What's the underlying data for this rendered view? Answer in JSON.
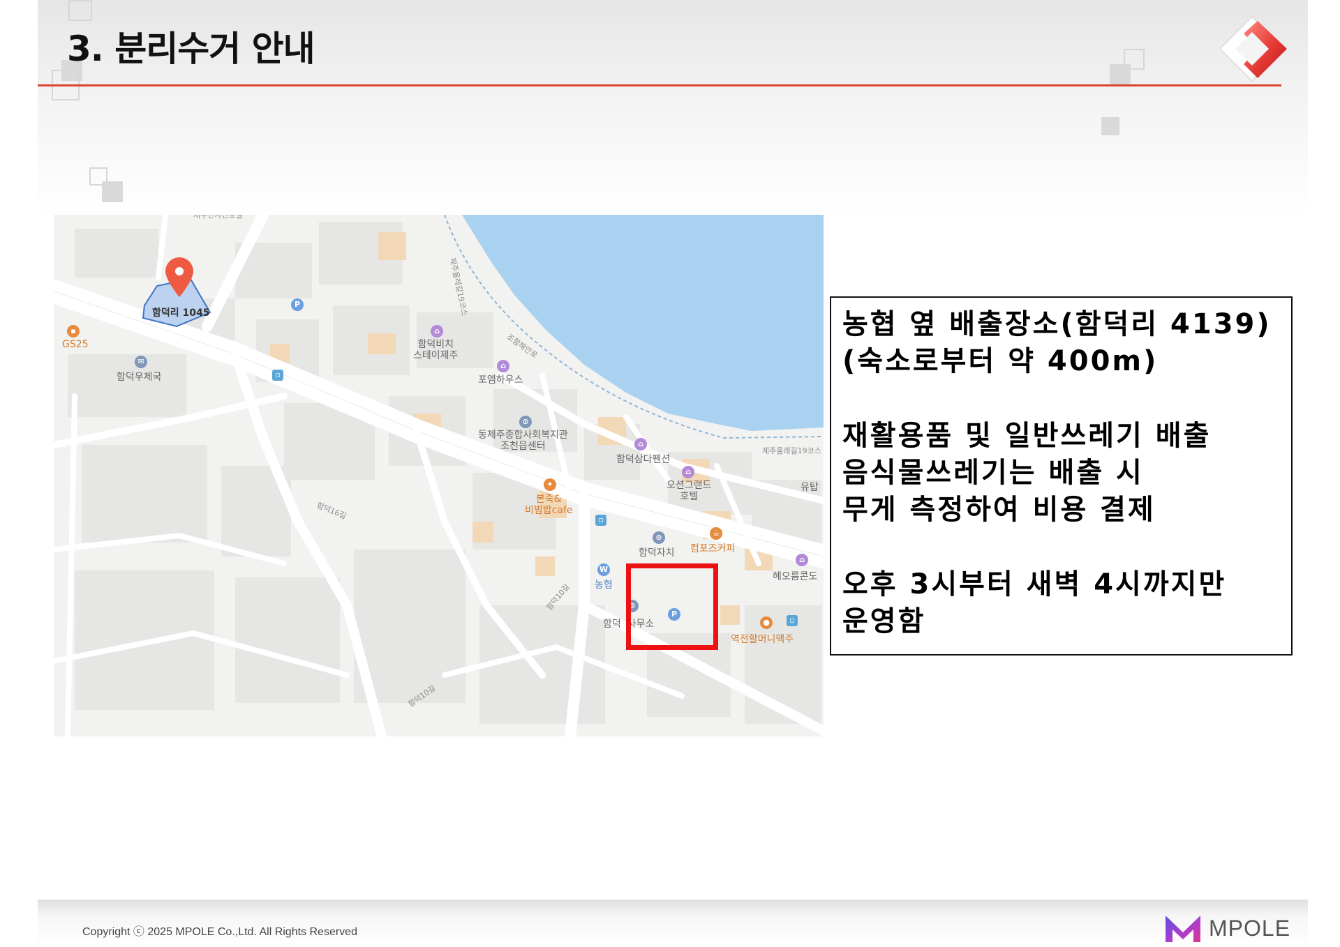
{
  "header": {
    "title": "3. 분리수거 안내"
  },
  "map": {
    "labels": {
      "top_cut": "제주민사진호텔",
      "pin_area": "함덕리 1045",
      "gs25": "GS25",
      "post_office": "함덕우체국",
      "stay_jeju": "함덕비치\n스테이제주",
      "forem": "포엠하우스",
      "coast_road": "조함해안로",
      "welfare": "동제주종합사회복지관\n조천읍센터",
      "samda": "함덕삼다펜션",
      "ocean_grand": "오션그랜드\n호텔",
      "bonjuk": "본죽&\n비빔밥cafe",
      "compose": "컴포즈커피",
      "autonomy": "함덕자치",
      "nonghyup": "농협",
      "office": "함덕  사무소",
      "yeokjeon": "역전할머니맥주",
      "heoreum": "헤오름콘도",
      "yutap": "유탑",
      "olle": "제주올레길19코스",
      "olle_vertical": "제주올레길19코스",
      "road_16": "함덕16길",
      "road_10a": "함덕10길",
      "road_10b": "함덕10길"
    }
  },
  "info": {
    "lines": [
      "농협 옆 배출장소(함덕리 4139)",
      "(숙소로부터 약 400m)",
      "재활용품 및 일반쓰레기 배출",
      "음식물쓰레기는 배출 시",
      "무게 측정하여 비용 결제",
      "오후 3시부터 새벽 4시까지만",
      "운영함"
    ]
  },
  "footer": {
    "copyright": "Copyright ⓒ 2025  MPOLE Co.,Ltd. All Rights Reserved",
    "brand": "MPOLE"
  },
  "colors": {
    "accent_red": "#d9452d",
    "highlight_red": "#ee1111",
    "sea_blue": "#a9d1f0",
    "brand_purple": "#8a3fd1"
  }
}
